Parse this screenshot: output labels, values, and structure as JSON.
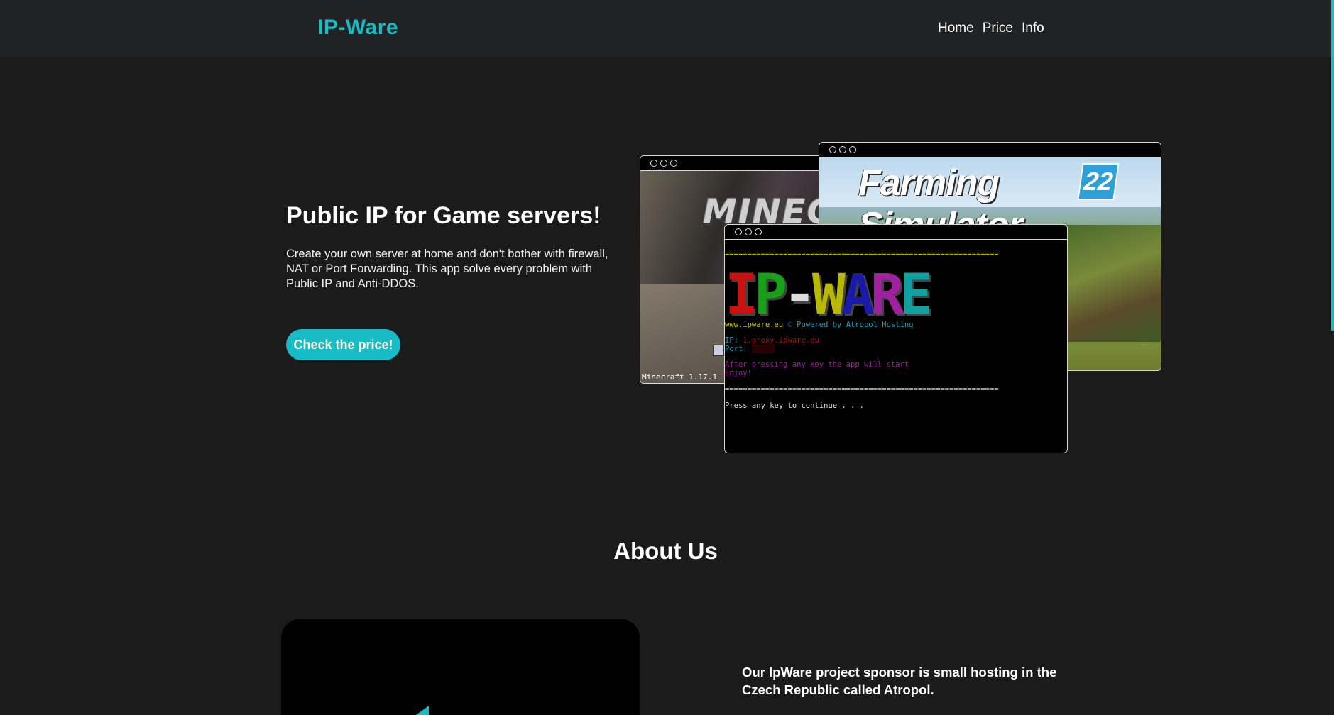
{
  "header": {
    "brand": "IP-Ware",
    "nav": [
      "Home",
      "Price",
      "Info"
    ]
  },
  "hero": {
    "title": "Public IP for Game servers!",
    "description": "Create your own server at home and don't bother with firewall, NAT or Port Forwarding. This app solve every problem with Public IP and Anti-DDOS.",
    "cta_label": "Check the price!"
  },
  "screenshots": {
    "minecraft": {
      "logo": "MINEC",
      "version": "Minecraft 1.17.1"
    },
    "farming_sim": {
      "logo": "Farming Simulator",
      "badge": "22"
    },
    "console": {
      "separator": "=============================================================",
      "logo_letters": [
        "I",
        "P",
        "-",
        "W",
        "A",
        "R",
        "E"
      ],
      "site_line": "www.ipware.eu",
      "powered_line": "Powered by Atropol Hosting",
      "ip_label": "IP:",
      "ip_value": "1.proxy.ipware.eu",
      "port_label": "Port:",
      "start_msg": "After pressing any key the app will start",
      "enjoy": "Enjoy!",
      "prompt": "Press any key to continue . . ."
    }
  },
  "about": {
    "title": "About Us",
    "text": "Our IpWare project sponsor is small hosting in the Czech Republic called Atropol."
  },
  "colors": {
    "accent": "#18bcc4",
    "background": "#1b1b1c",
    "header": "#202224"
  }
}
